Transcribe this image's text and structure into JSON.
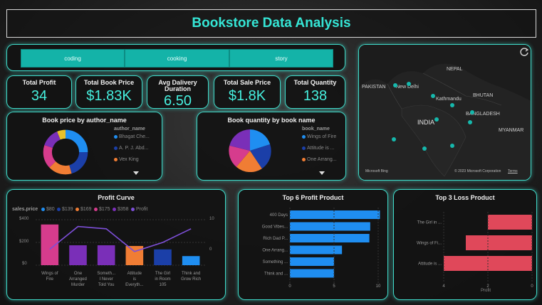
{
  "header": {
    "title": "Bookstore Data Analysis"
  },
  "slicers": [
    "coding",
    "cooking",
    "story"
  ],
  "kpis": [
    {
      "label": "Total Profit",
      "value": "34"
    },
    {
      "label": "Total Book Price",
      "value": "$1.83K"
    },
    {
      "label": "Avg Dalivery Duration",
      "value": "6.50"
    },
    {
      "label": "Total Sale Price",
      "value": "$1.8K"
    },
    {
      "label": "Total Quantity",
      "value": "138"
    }
  ],
  "map": {
    "labels": [
      "PAKISTAN",
      "New Delhi",
      "NEPAL",
      "BHUTAN",
      "Kathmandu",
      "BANGLADESH",
      "INDIA",
      "MYANMAR"
    ],
    "attribution": "© 2023 Microsoft Corporation",
    "terms": "Terms",
    "brand": "Microsoft Bing"
  },
  "donut": {
    "title": "Book price by author_name",
    "legend_title": "author_name",
    "legend": [
      "Bhagat Che...",
      "A. P. J. Abd...",
      "Vex King"
    ],
    "colors": [
      "#1f8ef1",
      "#1b3fa8",
      "#f07d34",
      "#d63c8d",
      "#7a2fb8",
      "#e8c12a"
    ]
  },
  "pie": {
    "title": "Book quantity by book name",
    "legend_title": "book_name",
    "legend": [
      "Wings of Fire",
      "Attitude is ...",
      "One Arrang..."
    ],
    "colors": [
      "#1f8ef1",
      "#1b3fa8",
      "#f07d34",
      "#d63c8d",
      "#7a2fb8"
    ]
  },
  "profit_curve": {
    "title": "Profit Curve",
    "legend_title": "sales.price",
    "legend": [
      {
        "label": "$80",
        "color": "#1f8ef1"
      },
      {
        "label": "$139",
        "color": "#1b3fa8"
      },
      {
        "label": "$169",
        "color": "#f07d34"
      },
      {
        "label": "$175",
        "color": "#d63c8d"
      },
      {
        "label": "$358",
        "color": "#7a2fb8"
      },
      {
        "label": "Profit",
        "color": "#7d4fd8"
      }
    ],
    "left_ticks": [
      "$400",
      "$200",
      "$0"
    ],
    "right_ticks": [
      "10",
      "0"
    ],
    "categories": [
      "Wings of Fire",
      "One Arranged Murder",
      "Someth... I Never Told You",
      "Attitude is Everyth...",
      "The Girl in Room 105",
      "Think and Grow Rich"
    ]
  },
  "chart_data": [
    {
      "type": "bar",
      "title": "Profit Curve",
      "categories": [
        "Wings of Fire",
        "One Arranged Murder",
        "Someth... I Never Told You",
        "Attitude is Everyth...",
        "The Girl in Room 105",
        "Think and Grow Rich"
      ],
      "series": [
        {
          "name": "sales.price",
          "values": [
            358,
            175,
            175,
            169,
            139,
            80
          ],
          "colors": [
            "#d63c8d",
            "#7a2fb8",
            "#7a2fb8",
            "#f07d34",
            "#1b3fa8",
            "#1f8ef1"
          ]
        },
        {
          "name": "Profit",
          "values": [
            -3,
            7,
            6,
            -4,
            0,
            6
          ]
        }
      ],
      "ylim": [
        0,
        400
      ],
      "y2lim": [
        -10,
        10
      ]
    },
    {
      "type": "bar",
      "title": "Top 6 Profit Product",
      "orientation": "horizontal",
      "categories": [
        "400 Days",
        "Good Vibes...",
        "Rich Dad P...",
        "One Arrang...",
        "Something ...",
        "Think and ..."
      ],
      "values": [
        10.2,
        9.1,
        9.0,
        5.9,
        5.0,
        5.0
      ],
      "xticks": [
        "0",
        "5",
        "10"
      ],
      "xlim": [
        0,
        10
      ]
    },
    {
      "type": "bar",
      "title": "Top 3 Loss Product",
      "orientation": "horizontal",
      "categories": [
        "The Girl in ...",
        "Wings of Fi...",
        "Attitude is ..."
      ],
      "values": [
        -2,
        -3,
        -4
      ],
      "xticks": [
        "4",
        "2",
        "0"
      ],
      "xlabel": "Profit",
      "xlim": [
        -4,
        0
      ]
    }
  ],
  "top_profit": {
    "title": "Top 6 Profit Product",
    "xticks": [
      "0",
      "5",
      "10"
    ]
  },
  "top_loss": {
    "title": "Top 3 Loss Product",
    "xticks": [
      "4",
      "2",
      "0"
    ],
    "xlabel": "Profit"
  }
}
